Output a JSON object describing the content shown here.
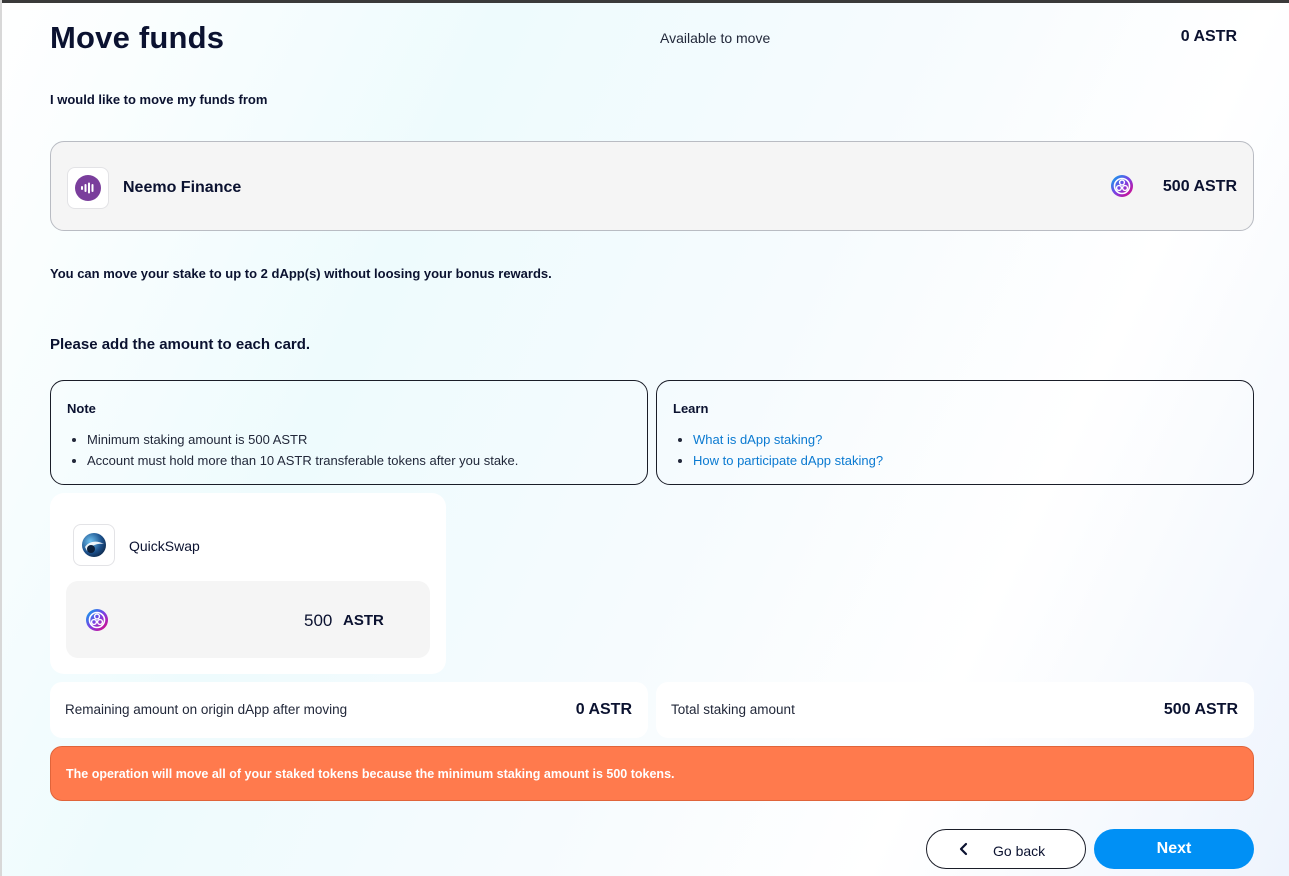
{
  "header": {
    "title": "Move funds",
    "available_label": "Available to move",
    "available_value": "0 ASTR"
  },
  "from": {
    "label": "I would like to move my funds from",
    "dapp_name": "Neemo Finance",
    "amount": "500 ASTR",
    "icon": "neemo-logo-icon",
    "token_icon": "astar-token-icon"
  },
  "hint": "You can move your stake to up to 2 dApp(s) without loosing your bonus rewards.",
  "instruction": "Please add the amount to each card.",
  "note": {
    "title": "Note",
    "items": [
      "Minimum staking amount is 500 ASTR",
      "Account must hold more than 10 ASTR transferable tokens after you stake."
    ]
  },
  "learn": {
    "title": "Learn",
    "links": [
      "What is dApp staking?",
      "How to participate dApp staking?"
    ]
  },
  "target": {
    "dapp_name": "QuickSwap",
    "amount": "500",
    "unit": "ASTR",
    "icon": "quickswap-logo-icon"
  },
  "summary": {
    "remaining_label": "Remaining amount on origin dApp after moving",
    "remaining_value": "0 ASTR",
    "total_label": "Total staking amount",
    "total_value": "500 ASTR"
  },
  "warning": "The operation will move all of your staked tokens because the minimum staking amount is 500 tokens.",
  "buttons": {
    "back": "Go back",
    "next": "Next"
  },
  "colors": {
    "accent": "#0090f5",
    "warning": "#ff7a4d",
    "neemo": "#7a3e9c",
    "link": "#0b7ad1"
  }
}
